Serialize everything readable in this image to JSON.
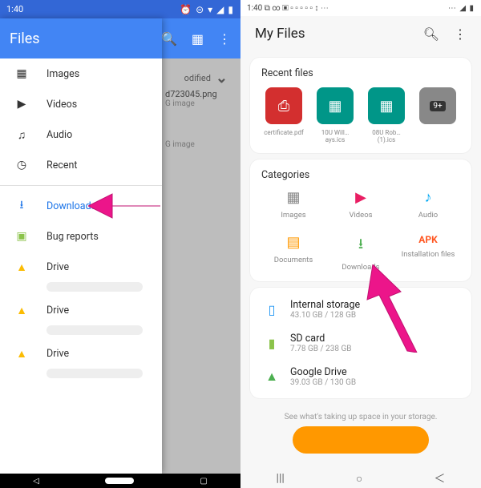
{
  "left": {
    "status": {
      "time": "1:40",
      "icons": "⏰ ⊝ ▾ ◢ ▮"
    },
    "app_title": "Files",
    "underlay": {
      "sort_label": "odified",
      "file1_name": "d723045.png",
      "file1_type": "G image",
      "file2_type": "G image"
    },
    "drawer": {
      "items": [
        {
          "icon": "▦",
          "label": "Images"
        },
        {
          "icon": "▶",
          "label": "Videos"
        },
        {
          "icon": "♫",
          "label": "Audio"
        },
        {
          "icon": "◷",
          "label": "Recent"
        }
      ],
      "downloads": {
        "icon": "⭳",
        "label": "Downloads"
      },
      "bugreports": {
        "icon": "🐛",
        "label": "Bug reports"
      },
      "drives": [
        {
          "icon": "▲",
          "label": "Drive"
        },
        {
          "icon": "▲",
          "label": "Drive"
        },
        {
          "icon": "▲",
          "label": "Drive"
        }
      ]
    }
  },
  "right": {
    "status": {
      "time": "1:40",
      "left_icons": "⧉ ∞ ▣ ▫ ▫ ▫ ▫ ▫ ↕ ⋯",
      "right_icons": "⋯ ◢ ▮"
    },
    "title": "My Files",
    "recent": {
      "heading": "Recent files",
      "items": [
        {
          "name": "certificate.pdf"
        },
        {
          "name": "10U Will…ays.ics"
        },
        {
          "name": "08U Rob…(1).ics"
        },
        {
          "name": "9+"
        }
      ]
    },
    "categories": {
      "heading": "Categories",
      "items": [
        {
          "icon": "▦",
          "label": "Images",
          "color": "#4caf50"
        },
        {
          "icon": "▶",
          "label": "Videos",
          "color": "#e91e63"
        },
        {
          "icon": "♪",
          "label": "Audio",
          "color": "#03a9f4"
        },
        {
          "icon": "▤",
          "label": "Documents",
          "color": "#ff9800"
        },
        {
          "icon": "⭳",
          "label": "Downloads",
          "color": "#4caf50"
        },
        {
          "icon": "APK",
          "label": "Installation files",
          "color": "#ff5722"
        }
      ]
    },
    "storage": {
      "items": [
        {
          "icon": "▯",
          "name": "Internal storage",
          "size": "43.10 GB / 128 GB",
          "color": "#2196f3"
        },
        {
          "icon": "▮",
          "name": "SD card",
          "size": "7.78 GB / 238 GB",
          "color": "#8bc34a"
        },
        {
          "icon": "▲",
          "name": "Google Drive",
          "size": "39.03 GB / 130 GB",
          "color": "#4caf50"
        }
      ]
    },
    "tip": "See what's taking up space in your storage."
  }
}
